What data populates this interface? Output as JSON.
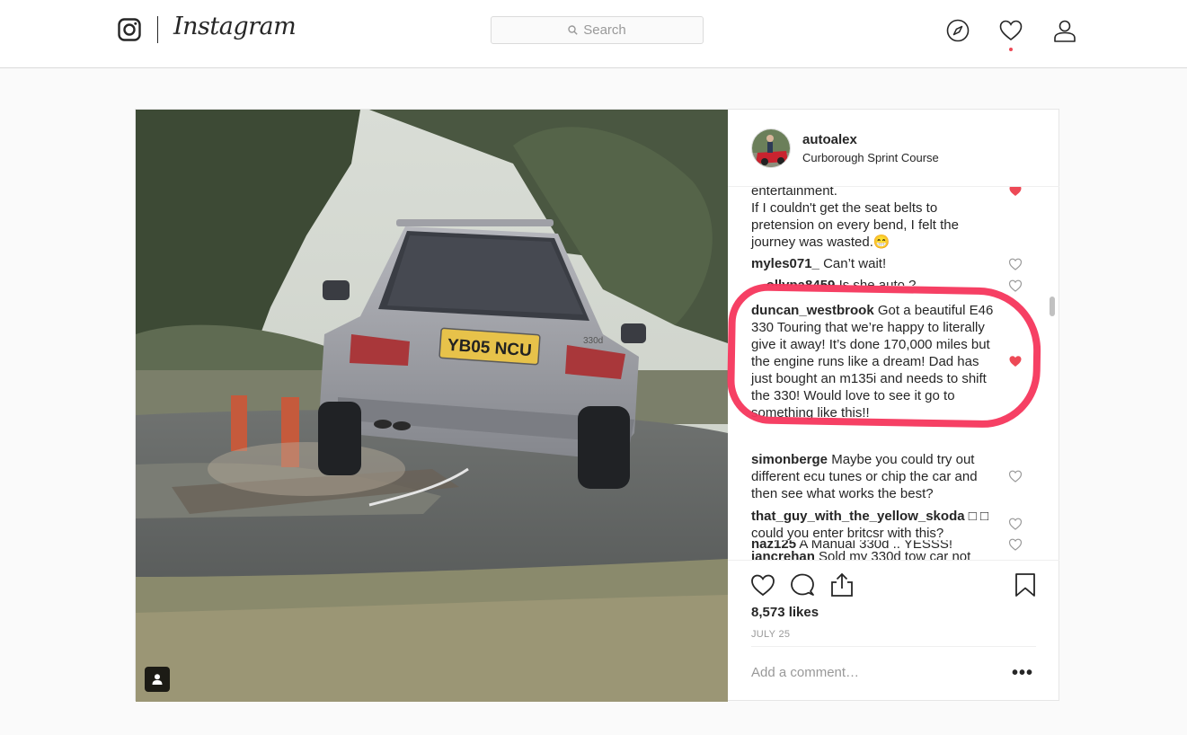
{
  "nav": {
    "wordmark": "Instagram",
    "search_placeholder": "Search"
  },
  "post": {
    "username": "autoalex",
    "location": "Curborough Sprint Course",
    "likes": "8,573 likes",
    "date": "JULY 25",
    "add_comment_placeholder": "Add a comment…",
    "more_options": "•••",
    "photo": {
      "license_plate": "YB05 NCU",
      "badge": "330d"
    },
    "comments": [
      {
        "author": "",
        "text": "entertainment.",
        "liked": true
      },
      {
        "author": "",
        "text": "If I couldn't get the seat belts to pretension on every bend, I felt the journey was wasted.😁",
        "liked": false
      },
      {
        "author": "myles071_",
        "text": "Can’t wait!",
        "liked": false
      },
      {
        "author": "__ollypa8459",
        "text": "Is she auto ?",
        "liked": false
      },
      {
        "author": "duncan_westbrook",
        "text": "Got a beautiful E46 330 Touring that we’re happy to literally give it away! It’s done 170,000 miles but the engine runs like a dream! Dad has just bought an m135i and needs to shift the 330! Would love to see it go to something like this!!",
        "liked": true
      },
      {
        "author": "naz125",
        "text": "A Manual 330d .. YESSS!",
        "liked": false
      },
      {
        "author": "simonberge",
        "text": "Maybe you could try out different ecu tunes or chip the car and then see what works the best?",
        "liked": false
      },
      {
        "author": "that_guy_with_the_yellow_skoda",
        "text": "□ □ could you enter britcsr with this?",
        "liked": false
      },
      {
        "author": "iancrehan",
        "text": "Sold my 330d tow car not",
        "liked": false
      }
    ]
  },
  "colors": {
    "heart_liked": "#ed4956",
    "annotation": "#f5365c",
    "notification_dot": "#ed4956"
  },
  "icons": [
    "instagram-glyph-icon",
    "search-icon",
    "explore-compass-icon",
    "activity-heart-icon",
    "profile-icon",
    "like-heart-icon",
    "comment-bubble-icon",
    "share-icon",
    "bookmark-icon",
    "tag-person-icon"
  ]
}
